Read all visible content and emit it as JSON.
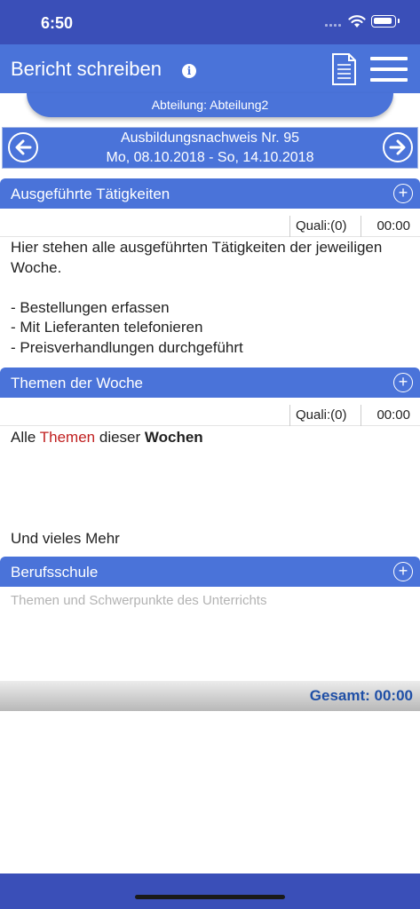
{
  "status_bar": {
    "time": "6:50"
  },
  "header": {
    "title": "Bericht schreiben"
  },
  "department": {
    "label": "Abteilung: Abteilung2"
  },
  "week": {
    "title": "Ausbildungsnachweis Nr. 95",
    "date_range": "Mo, 08.10.2018 - So, 14.10.2018"
  },
  "sections": [
    {
      "title": "Ausgeführte Tätigkeiten",
      "quali": "Quali:(0)",
      "hours": "00:00",
      "text": "Hier stehen alle ausgeführten Tätigkeiten der jeweiligen Woche.\n\n- Bestellungen erfassen\n- Mit Lieferanten telefonieren\n- Preisverhandlungen durchgeführt"
    },
    {
      "title": "Themen der Woche",
      "quali": "Quali:(0)",
      "hours": "00:00",
      "text_parts": {
        "p1": "Alle ",
        "p2": "Themen",
        "p3": " dieser ",
        "p4": "Wochen"
      },
      "text_end": "Und vieles Mehr"
    },
    {
      "title": "Berufsschule",
      "placeholder": "Themen und Schwerpunkte des Unterrichts"
    }
  ],
  "total": {
    "label": "Gesamt:  00:00"
  },
  "colors": {
    "accent": "#4a73d9",
    "system_bar": "#3a4fb8",
    "total_text": "#1f4fa6",
    "highlight": "#c01f1f"
  }
}
